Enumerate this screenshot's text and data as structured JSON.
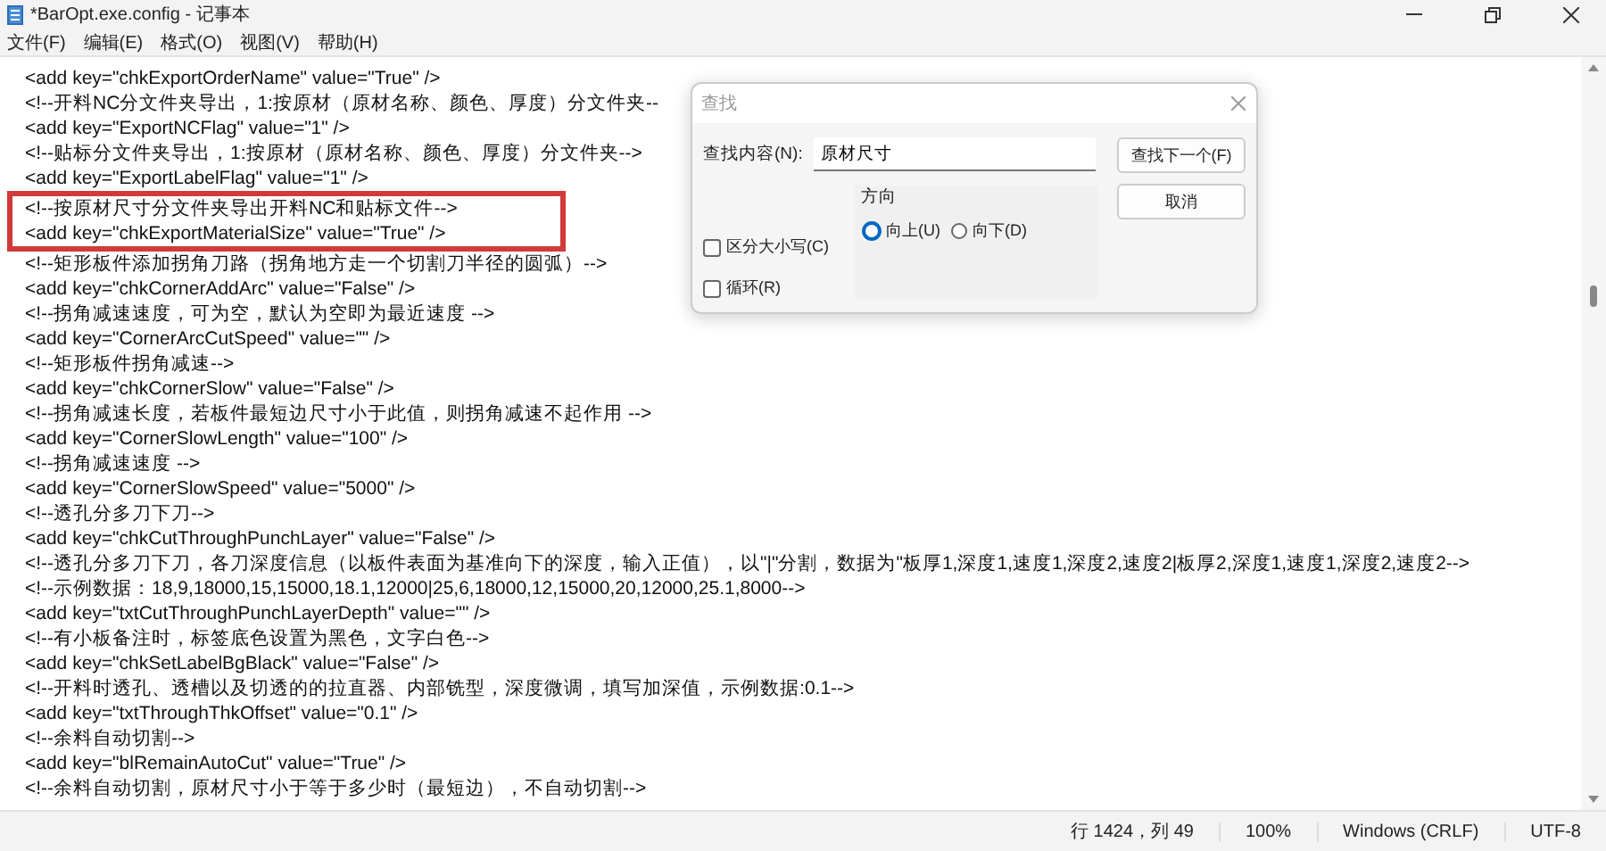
{
  "window": {
    "title": "*BarOpt.exe.config - 记事本"
  },
  "menu": [
    "文件(F)",
    "编辑(E)",
    "格式(O)",
    "视图(V)",
    "帮助(H)"
  ],
  "editor": {
    "lines": [
      {
        "text": "<add key=\"chkExportOrderName\" value=\"True\" />",
        "highlighted": false
      },
      {
        "text": "<!--开料NC分文件夹导出，1:按原材（原材名称、颜色、厚度）分文件夹--",
        "highlighted": false
      },
      {
        "text": "<add key=\"ExportNCFlag\" value=\"1\" />",
        "highlighted": false
      },
      {
        "text": "<!--贴标分文件夹导出，1:按原材（原材名称、颜色、厚度）分文件夹-->",
        "highlighted": false
      },
      {
        "text": "<add key=\"ExportLabelFlag\" value=\"1\" />",
        "highlighted": false
      },
      {
        "text": "<!--按原材尺寸分文件夹导出开料NC和贴标文件-->",
        "highlighted": true
      },
      {
        "text": "<add key=\"chkExportMaterialSize\" value=\"True\" />",
        "highlighted": true
      },
      {
        "text": "<!--矩形板件添加拐角刀路（拐角地方走一个切割刀半径的圆弧）-->",
        "highlighted": false
      },
      {
        "text": "<add key=\"chkCornerAddArc\" value=\"False\" />",
        "highlighted": false
      },
      {
        "text": "<!--拐角减速速度，可为空，默认为空即为最近速度 -->",
        "highlighted": false
      },
      {
        "text": "<add key=\"CornerArcCutSpeed\" value=\"\" />",
        "highlighted": false
      },
      {
        "text": "<!--矩形板件拐角减速-->",
        "highlighted": false
      },
      {
        "text": "<add key=\"chkCornerSlow\" value=\"False\" />",
        "highlighted": false
      },
      {
        "text": "<!--拐角减速长度，若板件最短边尺寸小于此值，则拐角减速不起作用 -->",
        "highlighted": false
      },
      {
        "text": "<add key=\"CornerSlowLength\" value=\"100\" />",
        "highlighted": false
      },
      {
        "text": "<!--拐角减速速度 -->",
        "highlighted": false
      },
      {
        "text": "<add key=\"CornerSlowSpeed\" value=\"5000\" />",
        "highlighted": false
      },
      {
        "text": "<!--透孔分多刀下刀-->",
        "highlighted": false
      },
      {
        "text": "<add key=\"chkCutThroughPunchLayer\" value=\"False\" />",
        "highlighted": false
      },
      {
        "text": "<!--透孔分多刀下刀，各刀深度信息（以板件表面为基准向下的深度，输入正值），以\"|\"分割，数据为\"板厚1,深度1,速度1,深度2,速度2|板厚2,深度1,速度1,深度2,速度2-->",
        "highlighted": false
      },
      {
        "text": "<!--示例数据：18,9,18000,15,15000,18.1,12000|25,6,18000,12,15000,20,12000,25.1,8000-->",
        "highlighted": false
      },
      {
        "text": "<add key=\"txtCutThroughPunchLayerDepth\" value=\"\" />",
        "highlighted": false
      },
      {
        "text": "<!--有小板备注时，标签底色设置为黑色，文字白色-->",
        "highlighted": false
      },
      {
        "text": "<add key=\"chkSetLabelBgBlack\" value=\"False\" />",
        "highlighted": false
      },
      {
        "text": "<!--开料时透孔、透槽以及切透的的拉直器、内部铣型，深度微调，填写加深值，示例数据:0.1-->",
        "highlighted": false
      },
      {
        "text": "<add key=\"txtThroughThkOffset\" value=\"0.1\" />",
        "highlighted": false
      },
      {
        "text": "<!--余料自动切割-->",
        "highlighted": false
      },
      {
        "text": "<add key=\"blRemainAutoCut\" value=\"True\" />",
        "highlighted": false
      },
      {
        "text": "<!--余料自动切割，原材尺寸小于等于多少时（最短边），不自动切割-->",
        "highlighted": false
      }
    ]
  },
  "find_dialog": {
    "title": "查找",
    "find_label": "查找内容(N):",
    "find_value": "原材尺寸",
    "buttons": [
      "查找下一个(F)",
      "取消"
    ],
    "direction_label": "方向",
    "directions": [
      {
        "label": "向上(U)",
        "selected": true
      },
      {
        "label": "向下(D)",
        "selected": false
      }
    ],
    "options": [
      {
        "label": "区分大小写(C)",
        "checked": false
      },
      {
        "label": "循环(R)",
        "checked": false
      }
    ]
  },
  "status_bar": {
    "position": "行 1424，列 49",
    "zoom": "100%",
    "line_ending": "Windows (CRLF)",
    "encoding": "UTF-8"
  }
}
